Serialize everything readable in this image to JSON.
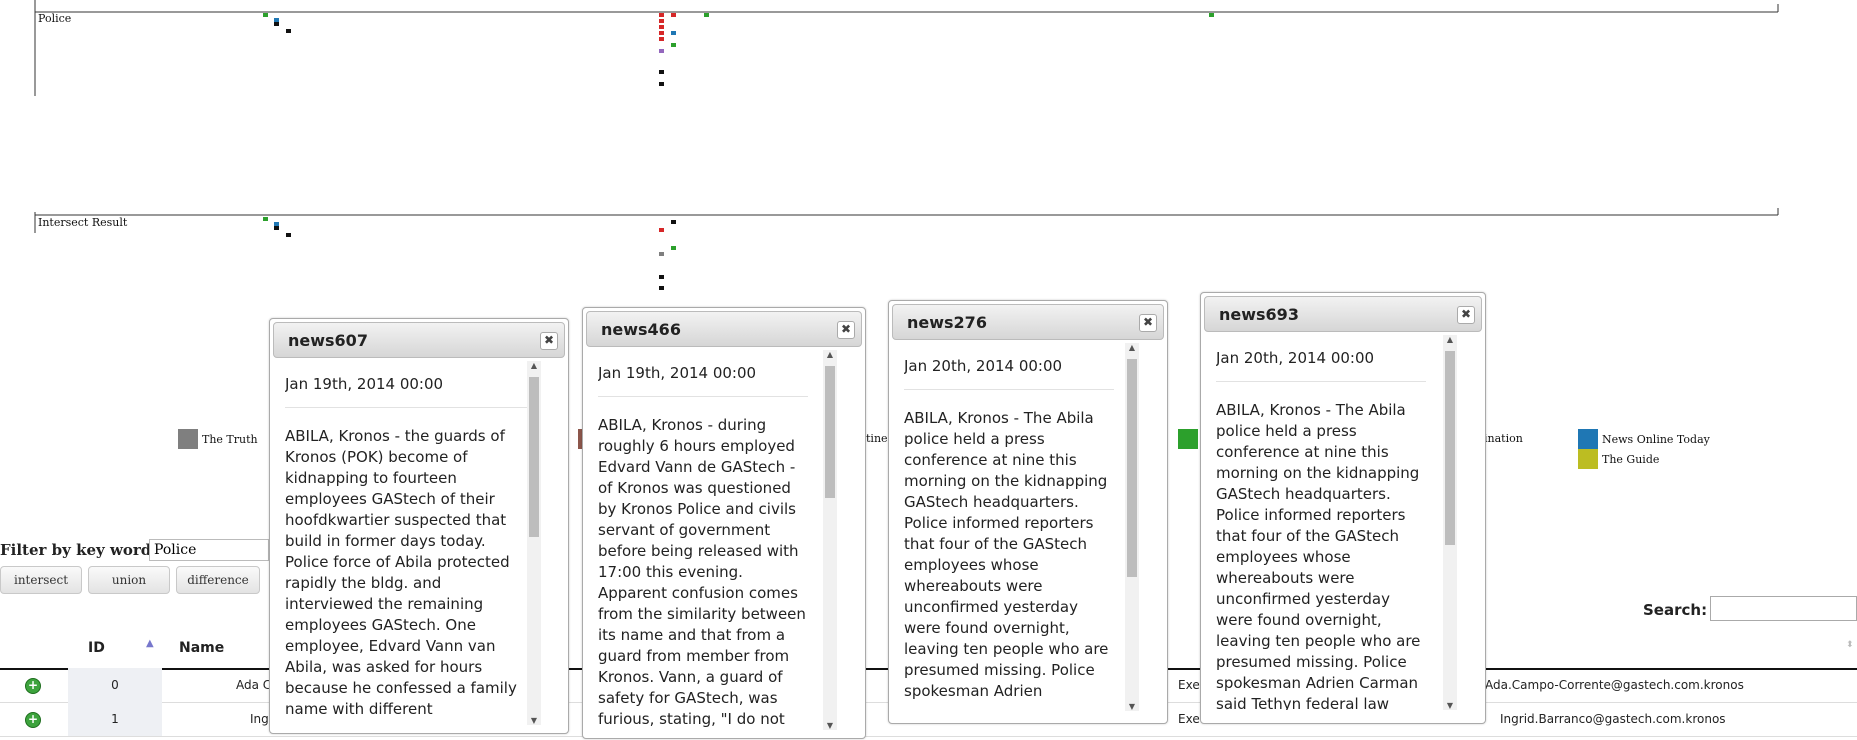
{
  "timeline": {
    "tracks": [
      {
        "label": "Police"
      },
      {
        "label": "Intersect Result"
      }
    ]
  },
  "legend": {
    "items": [
      {
        "label": "The Truth",
        "color": "#7f7f7f"
      },
      {
        "label": "",
        "color": "#8c564b"
      },
      {
        "label": "tine",
        "color": "#d62728"
      },
      {
        "label": "",
        "color": "#2ca02c"
      },
      {
        "label": "ination",
        "color": "#9467bd"
      },
      {
        "label": "News Online Today",
        "color": "#1f77b4"
      },
      {
        "label": "The Guide",
        "color": "#bcbd22"
      }
    ]
  },
  "filter": {
    "label": "Filter by key word:",
    "value": "Police",
    "buttons": [
      "intersect",
      "union",
      "difference"
    ]
  },
  "table": {
    "search_label": "Search:",
    "columns": {
      "id": "ID",
      "name": "Name"
    },
    "rows": [
      {
        "id": "0",
        "name": "Ada C",
        "title": "Exec",
        "email": "Ada.Campo-Corrente@gastech.com.kronos"
      },
      {
        "id": "1",
        "name": "Ing",
        "title": "Executive",
        "email": "Ingrid.Barranco@gastech.com.kronos"
      }
    ]
  },
  "dialogs": [
    {
      "title": "news607",
      "date": "Jan 19th, 2014 00:00",
      "body": "ABILA, Kronos - the guards of Kronos (POK) become of kidnapping to fourteen employees GAStech of their hoofdkwartier suspected that build in former days today. Police force of Abila protected rapidly the bldg. and interviewed the remaining employees GAStech. One employee, Edvard Vann van Abila, was asked for hours because he confessed a family name with different"
    },
    {
      "title": "news466",
      "date": "Jan 19th, 2014 00:00",
      "body": "ABILA, Kronos - during roughly 6 hours employed Edvard Vann de GAStech - of Kronos was questioned by Kronos Police and civils servant of government before being released with 17:00 this evening. Apparent confusion comes from the similarity between its name and that from a guard from member from Kronos. Vann, a guard of safety for GAStech, was furious, stating, \"I do not"
    },
    {
      "title": "news276",
      "date": "Jan 20th, 2014 00:00",
      "body": "ABILA, Kronos - The Abila police held a press conference at nine this morning on the kidnapping GAStech headquarters. Police informed reporters that four of the GAStech employees whose whereabouts were unconfirmed yesterday were found overnight, leaving ten people who are presumed missing. Police spokesman Adrien"
    },
    {
      "title": "news693",
      "date": "Jan 20th, 2014 00:00",
      "body": "ABILA, Kronos - The Abila police held a press conference at nine this morning on the kidnapping GAStech headquarters. Police informed reporters that four of the GAStech employees whose whereabouts were unconfirmed yesterday were found overnight, leaving ten people who are presumed missing. Police spokesman Adrien Carman said Tethyn federal law"
    }
  ]
}
